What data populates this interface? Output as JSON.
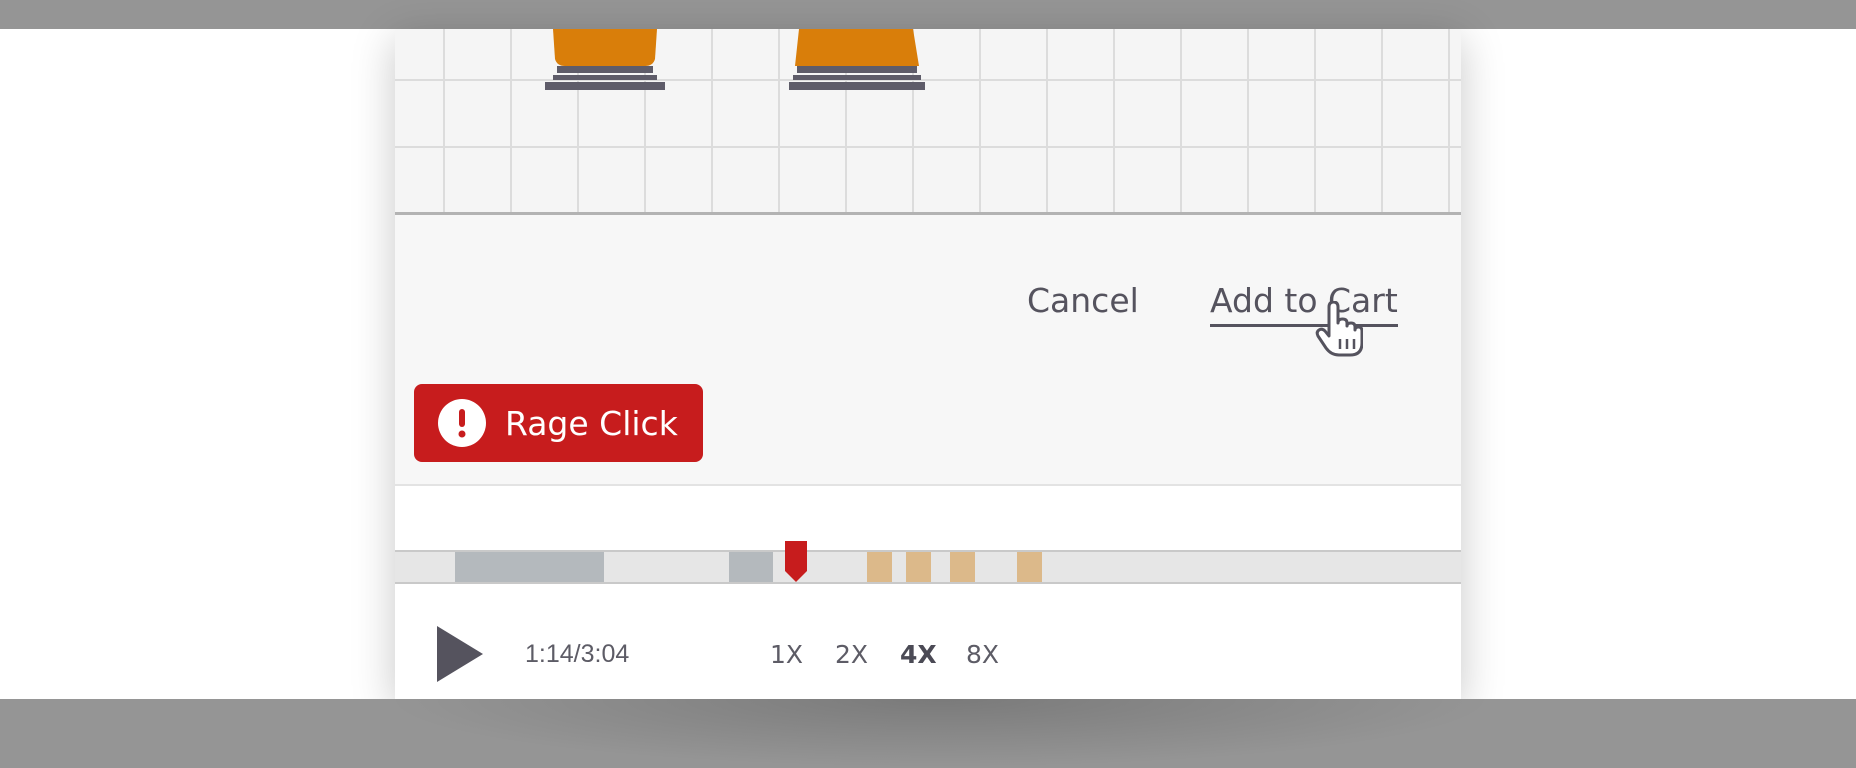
{
  "actions": {
    "cancel_label": "Cancel",
    "add_to_cart_label": "Add to Cart"
  },
  "alert": {
    "label": "Rage Click",
    "icon": "exclamation-icon",
    "color": "#c71c1d"
  },
  "player": {
    "time": "1:14/3:04",
    "speeds": [
      {
        "label": "1X",
        "active": false
      },
      {
        "label": "2X",
        "active": false
      },
      {
        "label": "4X",
        "active": true
      },
      {
        "label": "8X",
        "active": false
      }
    ],
    "colors": {
      "session_segment": "#b4b9bd",
      "event_marker": "#dcb98a",
      "playhead": "#c71c1d"
    }
  },
  "icons": [
    "play-icon",
    "hand-pointer-cursor-icon",
    "exclamation-icon"
  ]
}
